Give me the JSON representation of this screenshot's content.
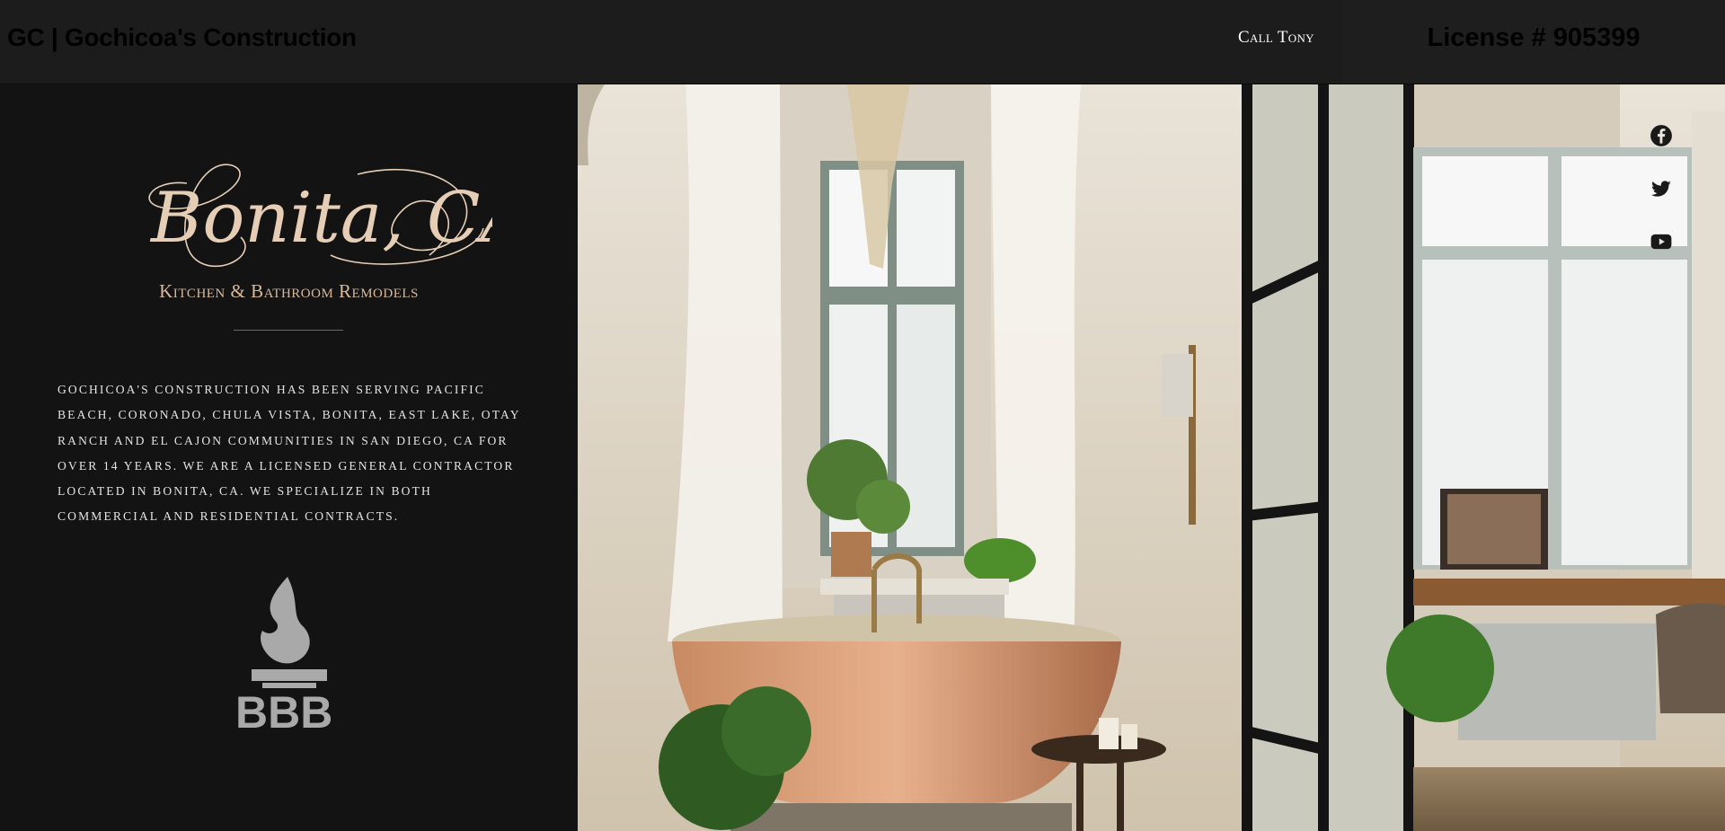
{
  "header": {
    "brand": "GC | Gochicoa's Construction",
    "call_label": "Call Tony",
    "license": "License # 905399"
  },
  "sidebar": {
    "logo_script": "Bonita, CA",
    "tagline": "Kitchen & Bathroom Remodels",
    "description": "Gochicoa's Construction has been serving Pacific Beach, Coronado, Chula Vista, Bonita, East Lake, Otay Ranch and El Cajon communities in San Diego, CA for over 14 years. We are a licensed general contractor located in Bonita, CA. We specialize in both commercial and residential contracts.",
    "bbb_text": "BBB"
  },
  "social": {
    "icons": [
      "facebook-icon",
      "twitter-icon",
      "youtube-icon"
    ]
  },
  "colors": {
    "header_bg": "#1c1c1c",
    "panel_bg": "#131313",
    "accent_gold": "#d8b99a"
  }
}
